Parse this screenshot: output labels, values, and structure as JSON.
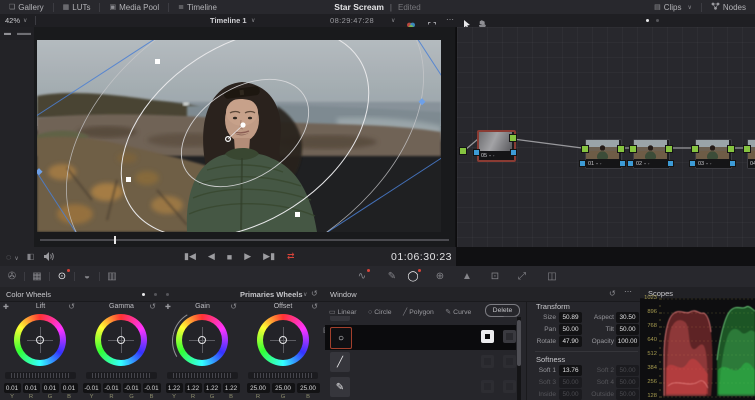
{
  "header": {
    "menu": [
      "Gallery",
      "LUTs",
      "Media Pool",
      "Timeline"
    ],
    "project_title": "Star Scream",
    "project_status": "Edited",
    "clips_label": "Clips",
    "nodes_label": "Nodes"
  },
  "viewer": {
    "zoom_level": "42%",
    "timeline_name": "Timeline 1",
    "clip_timecode": "08:29:47:28",
    "playhead_timecode": "01:06:30:23"
  },
  "node_graph": {
    "nodes": [
      {
        "label": "05"
      },
      {
        "label": "01"
      },
      {
        "label": "02"
      },
      {
        "label": "03"
      },
      {
        "label": "04"
      }
    ]
  },
  "color_wheels": {
    "title": "Color Wheels",
    "mode": "Primaries Wheels",
    "wheels": [
      {
        "name": "Lift",
        "letters": [
          "Y",
          "R",
          "G",
          "B"
        ],
        "values": [
          "0.01",
          "0.01",
          "0.01",
          "0.01"
        ]
      },
      {
        "name": "Gamma",
        "letters": [
          "Y",
          "R",
          "G",
          "B"
        ],
        "values": [
          "-0.01",
          "-0.01",
          "-0.01",
          "-0.01"
        ]
      },
      {
        "name": "Gain",
        "letters": [
          "Y",
          "R",
          "G",
          "B"
        ],
        "values": [
          "1.22",
          "1.22",
          "1.22",
          "1.22"
        ]
      },
      {
        "name": "Offset",
        "letters": [
          "R",
          "G",
          "B"
        ],
        "values": [
          "25.00",
          "25.00",
          "25.00"
        ]
      }
    ]
  },
  "window_panel": {
    "title": "Window",
    "tools": [
      {
        "label": "Linear"
      },
      {
        "label": "Circle"
      },
      {
        "label": "Polygon"
      },
      {
        "label": "Curve"
      },
      {
        "label": "Gradient"
      }
    ],
    "delete_label": "Delete",
    "transform": {
      "title": "Transform",
      "fields": [
        {
          "label": "Size",
          "value": "50.89"
        },
        {
          "label": "Aspect",
          "value": "30.50"
        },
        {
          "label": "Pan",
          "value": "50.00"
        },
        {
          "label": "Tilt",
          "value": "50.00"
        },
        {
          "label": "Rotate",
          "value": "47.90"
        },
        {
          "label": "Opacity",
          "value": "100.00"
        }
      ]
    },
    "softness": {
      "title": "Softness",
      "fields": [
        {
          "label": "Soft 1",
          "value": "13.76"
        },
        {
          "label": "Soft 2",
          "value": "50.00"
        },
        {
          "label": "Soft 3",
          "value": "50.00"
        },
        {
          "label": "Soft 4",
          "value": "50.00"
        },
        {
          "label": "Inside",
          "value": "50.00"
        },
        {
          "label": "Outside",
          "value": "50.00"
        }
      ]
    }
  },
  "scopes": {
    "title": "Scopes",
    "axis_labels": [
      "1023",
      "896",
      "768",
      "640",
      "512",
      "384",
      "256",
      "128"
    ]
  },
  "colors": {
    "accent_red": "#d9443a",
    "node_green": "#86c440",
    "node_blue": "#3d9bd6",
    "scope_red": "#e85555",
    "scope_green": "#3ec95a"
  }
}
